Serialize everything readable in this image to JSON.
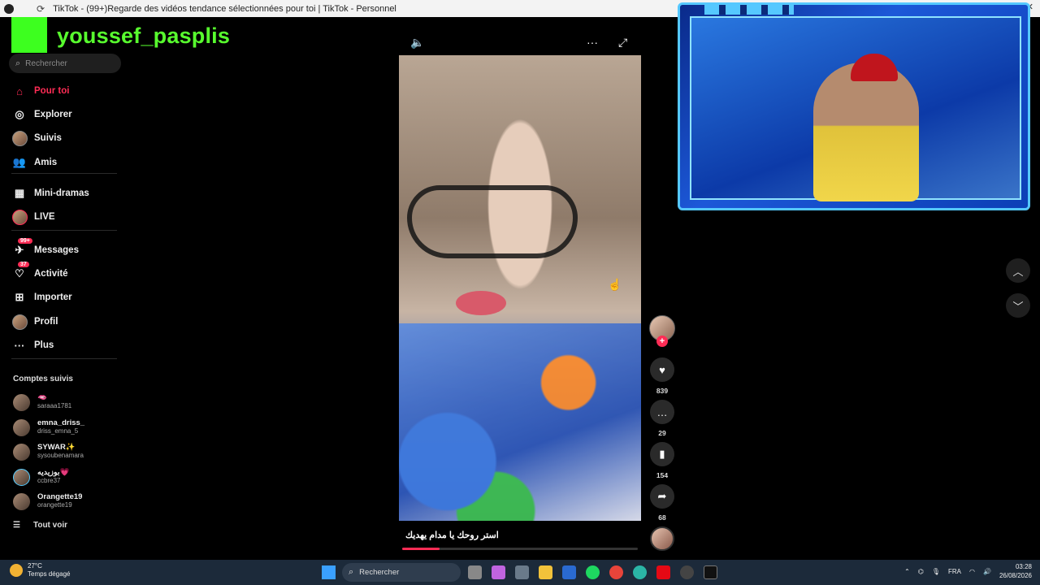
{
  "browser": {
    "title": "TikTok - (99+)Regarde des vidéos tendance sélectionnées pour toi | TikTok - Personnel"
  },
  "overlay": {
    "channel_name": "youssef_pasplis"
  },
  "sidebar": {
    "search_placeholder": "Rechercher",
    "nav": [
      {
        "label": "Pour toi",
        "icon": "home-icon",
        "active": true
      },
      {
        "label": "Explorer",
        "icon": "compass-icon"
      },
      {
        "label": "Suivis",
        "icon": "avatar-icon"
      },
      {
        "label": "Amis",
        "icon": "friends-icon"
      },
      {
        "label": "Mini-dramas",
        "icon": "film-icon"
      },
      {
        "label": "LIVE",
        "icon": "live-icon"
      },
      {
        "label": "Messages",
        "icon": "messages-icon",
        "badge": "99+"
      },
      {
        "label": "Activité",
        "icon": "activity-icon",
        "badge": "37"
      },
      {
        "label": "Importer",
        "icon": "upload-icon"
      },
      {
        "label": "Profil",
        "icon": "profile-icon"
      },
      {
        "label": "Plus",
        "icon": "more-icon"
      }
    ],
    "following_title": "Comptes suivis",
    "following": [
      {
        "name": "🫦",
        "handle": "saraaa1781"
      },
      {
        "name": "emna_driss_",
        "handle": "driss_emna_5"
      },
      {
        "name": "SYWAR✨",
        "handle": "sysoubenamara"
      },
      {
        "name": "بوزيديه💗",
        "handle": "ccbre37"
      },
      {
        "name": "Orangette19",
        "handle": "orangette19"
      }
    ],
    "see_all": "Tout voir"
  },
  "video": {
    "caption": "استر روحك يا مدام يهديك",
    "progress": 0.16,
    "likes": "839",
    "comments": "29",
    "saves": "154",
    "shares": "68"
  },
  "taskbar": {
    "temperature": "27°C",
    "weather": "Temps dégagé",
    "search_placeholder": "Rechercher",
    "language": "FRA",
    "time": "03:28",
    "date": "26/08/2026"
  },
  "colors": {
    "accent": "#fe2c55",
    "overlay_green": "#58ff2e",
    "webcam_border": "#55c8ff"
  }
}
